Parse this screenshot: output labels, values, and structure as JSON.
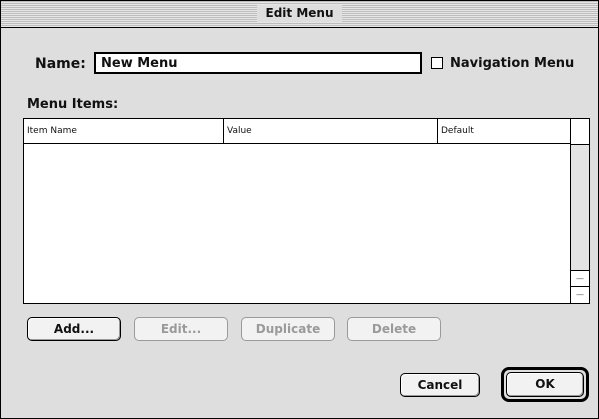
{
  "window": {
    "title": "Edit Menu"
  },
  "form": {
    "name_label": "Name:",
    "name_value": "New Menu",
    "navigation_checkbox_label": "Navigation Menu",
    "navigation_checked": false
  },
  "menu_items": {
    "label": "Menu Items:",
    "columns": [
      "Item Name",
      "Value",
      "Default"
    ],
    "rows": []
  },
  "buttons": {
    "add": "Add...",
    "edit": "Edit...",
    "duplicate": "Duplicate",
    "delete": "Delete",
    "cancel": "Cancel",
    "ok": "OK"
  },
  "scrollbar": {
    "up_arrow": "—",
    "down_arrow": "—"
  }
}
